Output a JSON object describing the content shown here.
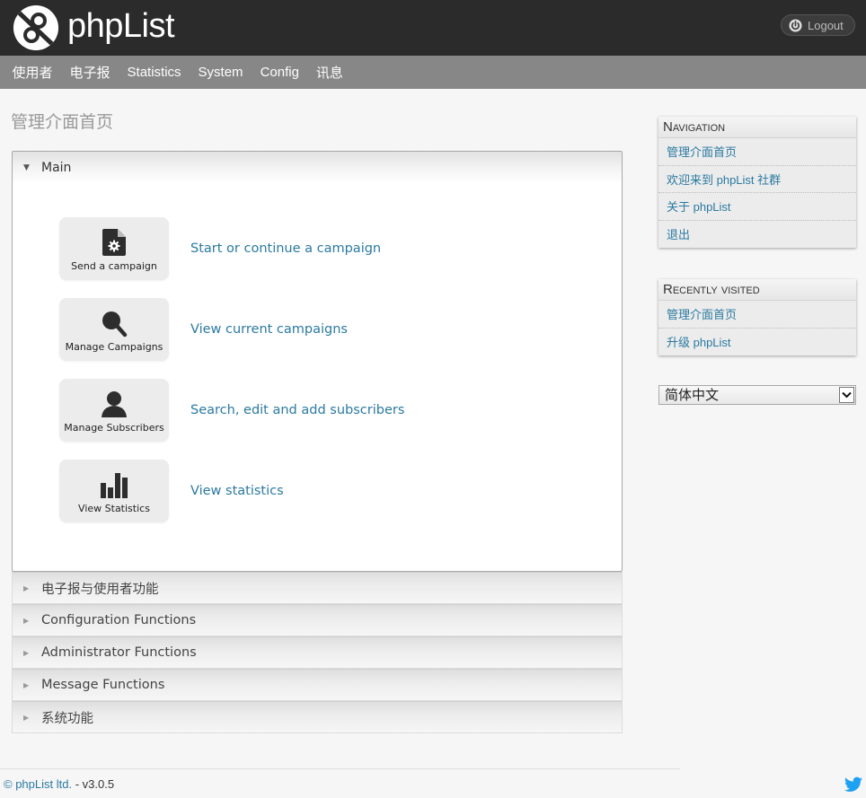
{
  "header": {
    "logo_text": "phpList",
    "logout_label": "Logout",
    "logout_icon": "power-icon"
  },
  "menu": [
    {
      "label": "使用者"
    },
    {
      "label": "电子报"
    },
    {
      "label": "Statistics"
    },
    {
      "label": "System"
    },
    {
      "label": "Config"
    },
    {
      "label": "讯息"
    }
  ],
  "page_title": "管理介面首页",
  "accordion": {
    "main": {
      "label": "Main",
      "expanded": true,
      "tiles": [
        {
          "icon": "document-gear-icon",
          "label": "Send a campaign",
          "link": "Start or continue a campaign"
        },
        {
          "icon": "magnifier-icon",
          "label": "Manage Campaigns",
          "link": "View current campaigns"
        },
        {
          "icon": "user-icon",
          "label": "Manage Subscribers",
          "link": "Search, edit and add subscribers"
        },
        {
          "icon": "bar-chart-icon",
          "label": "View Statistics",
          "link": "View statistics"
        }
      ]
    },
    "sections": [
      {
        "label": "电子报与使用者功能",
        "expanded": false
      },
      {
        "label": "Configuration Functions",
        "expanded": false
      },
      {
        "label": "Administrator Functions",
        "expanded": false
      },
      {
        "label": "Message Functions",
        "expanded": false
      },
      {
        "label": "系统功能",
        "expanded": false
      }
    ]
  },
  "sidebar": {
    "navigation": {
      "title": "Navigation",
      "items": [
        {
          "label": "管理介面首页"
        },
        {
          "label": "欢迎来到 phpList 社群"
        },
        {
          "label": "关于 phpList"
        },
        {
          "label": "退出"
        }
      ]
    },
    "recently_visited": {
      "title": "Recently visited",
      "items": [
        {
          "label": "管理介面首页"
        },
        {
          "label": "升级 phpList"
        }
      ]
    },
    "language_select": {
      "selected": "简体中文"
    }
  },
  "footer": {
    "copyright_link": "© phpList ltd.",
    "version": " - v3.0.5",
    "social_icon": "twitter-icon"
  },
  "colors": {
    "link": "#2a7aa0",
    "topbar": "#2b2b2b",
    "menubar": "#878787",
    "twitter": "#1da1f2"
  }
}
